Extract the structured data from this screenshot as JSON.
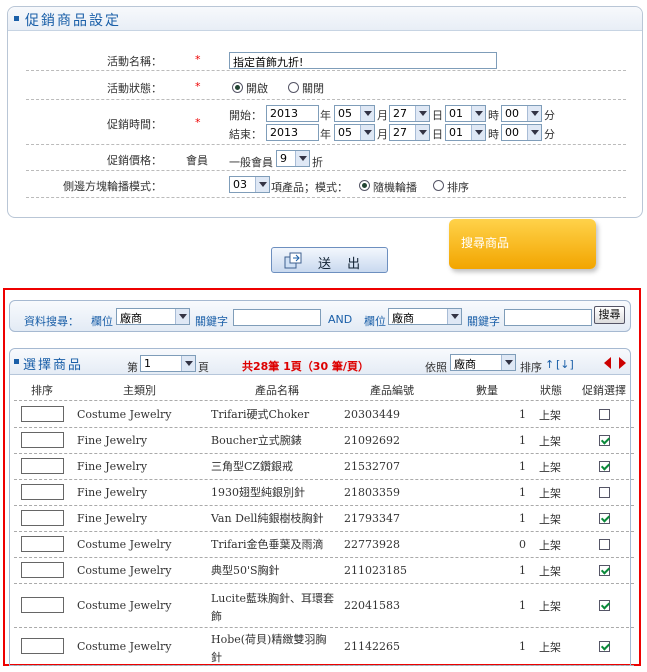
{
  "form": {
    "title": "促銷商品設定",
    "name_label": "活動名稱：",
    "name_value": "指定首飾九折!",
    "status_label": "活動狀態：",
    "status_on": "開啟",
    "status_off": "關閉",
    "time_label": "促銷時間：",
    "start_label": "開始：",
    "end_label": "結束：",
    "start": {
      "year": "2013",
      "month": "05",
      "day": "27",
      "hour": "01",
      "minute": "00"
    },
    "end": {
      "year": "2013",
      "month": "05",
      "day": "27",
      "hour": "01",
      "minute": "00"
    },
    "unit_year": "年",
    "unit_month": "月",
    "unit_day": "日",
    "unit_hour": "時",
    "unit_minute": "分",
    "price_label": "促銷價格：",
    "member_label": "會員",
    "general_member": "一般會員",
    "discount_value": "9",
    "discount_unit": "折",
    "carousel_label": "側邊方塊輪播模式：",
    "carousel_count": "03",
    "carousel_items_text": "項產品；模式：",
    "mode_random": "隨機輪播",
    "mode_sort": "排序",
    "required_mark": "*"
  },
  "submit_label": "送 出",
  "tooltip": "搜尋商品",
  "search": {
    "label": "資料搜尋：",
    "field_label": "欄位",
    "field_value": "廠商",
    "keyword_label": "關鍵字",
    "and_label": "AND",
    "field2_value": "廠商",
    "button": "搜尋"
  },
  "list": {
    "title": "選擇商品",
    "page_prefix": "第",
    "page_value": "1",
    "page_suffix": "頁",
    "summary": "共28筆 1頁（30 筆/頁）",
    "sort_by": "依照",
    "sort_field": "廠商",
    "sort_label": "排序",
    "sort_asc": "↑",
    "sort_desc": "[↓]",
    "headers": [
      "排序",
      "主類別",
      "產品名稱",
      "產品編號",
      "數量",
      "狀態",
      "促銷選擇"
    ],
    "rows": [
      {
        "category": "Costume Jewelry",
        "name": "Trifari硬式Choker",
        "code": "20303449",
        "qty": "1",
        "status": "上架",
        "checked": false
      },
      {
        "category": "Fine Jewelry",
        "name": "Boucher立式腕錶",
        "code": "21092692",
        "qty": "1",
        "status": "上架",
        "checked": true
      },
      {
        "category": "Fine Jewelry",
        "name": "三角型CZ鑽銀戒",
        "code": "21532707",
        "qty": "1",
        "status": "上架",
        "checked": true
      },
      {
        "category": "Fine Jewelry",
        "name": "1930翅型純銀別針",
        "code": "21803359",
        "qty": "1",
        "status": "上架",
        "checked": false
      },
      {
        "category": "Fine Jewelry",
        "name": "Van Dell純銀樹枝胸針",
        "code": "21793347",
        "qty": "1",
        "status": "上架",
        "checked": true
      },
      {
        "category": "Costume Jewelry",
        "name": "Trifari金色垂葉及雨滴",
        "code": "22773928",
        "qty": "0",
        "status": "上架",
        "checked": false
      },
      {
        "category": "Costume Jewelry",
        "name": "典型50'S胸針",
        "code": "211023185",
        "qty": "1",
        "status": "上架",
        "checked": true
      },
      {
        "category": "Costume Jewelry",
        "name": "Lucite藍珠胸針、耳環套",
        "name2": "飾",
        "code": "22041583",
        "qty": "1",
        "status": "上架",
        "checked": true
      },
      {
        "category": "Costume Jewelry",
        "name": "Hobe(荷貝)精緻雙羽胸",
        "name2": "針",
        "code": "21142265",
        "qty": "1",
        "status": "上架",
        "checked": true
      }
    ]
  }
}
